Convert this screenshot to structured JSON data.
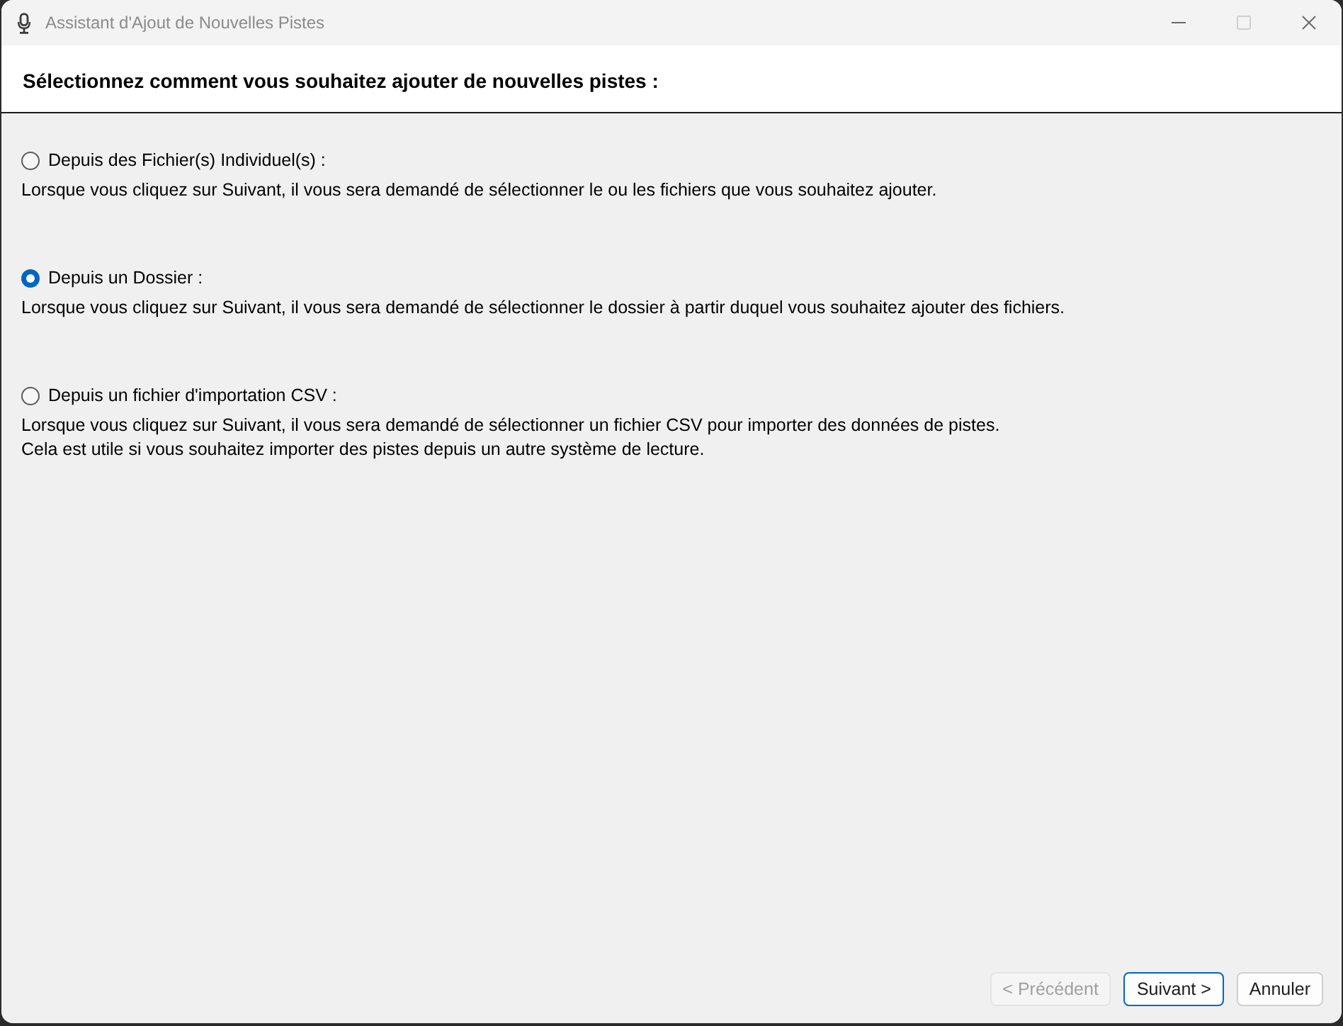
{
  "window": {
    "title": "Assistant d'Ajout de Nouvelles Pistes",
    "controls": [
      {
        "kind": "minimize",
        "disabled": false
      },
      {
        "kind": "maximize",
        "disabled": true
      },
      {
        "kind": "close",
        "disabled": false
      }
    ]
  },
  "header": {
    "title": "Sélectionnez comment vous souhaitez ajouter de nouvelles pistes :"
  },
  "options": [
    {
      "label": "Depuis des Fichier(s) Individuel(s) :",
      "selected": false,
      "description": [
        "Lorsque vous cliquez sur Suivant, il vous sera demandé de sélectionner le ou les fichiers que vous souhaitez ajouter."
      ]
    },
    {
      "label": "Depuis un Dossier :",
      "selected": true,
      "description": [
        "Lorsque vous cliquez sur Suivant, il vous sera demandé de sélectionner le dossier à partir duquel vous souhaitez ajouter des fichiers."
      ]
    },
    {
      "label": "Depuis un fichier d'importation CSV :",
      "selected": false,
      "description": [
        "Lorsque vous cliquez sur Suivant, il vous sera demandé de sélectionner un fichier CSV pour importer des données de pistes.",
        "Cela est utile si vous souhaitez importer des pistes depuis un autre système de lecture."
      ]
    }
  ],
  "buttons": [
    {
      "label": "< Précédent",
      "disabled": true,
      "default": false
    },
    {
      "label": "Suivant >",
      "disabled": false,
      "default": true
    },
    {
      "label": "Annuler",
      "disabled": false,
      "default": false
    }
  ]
}
